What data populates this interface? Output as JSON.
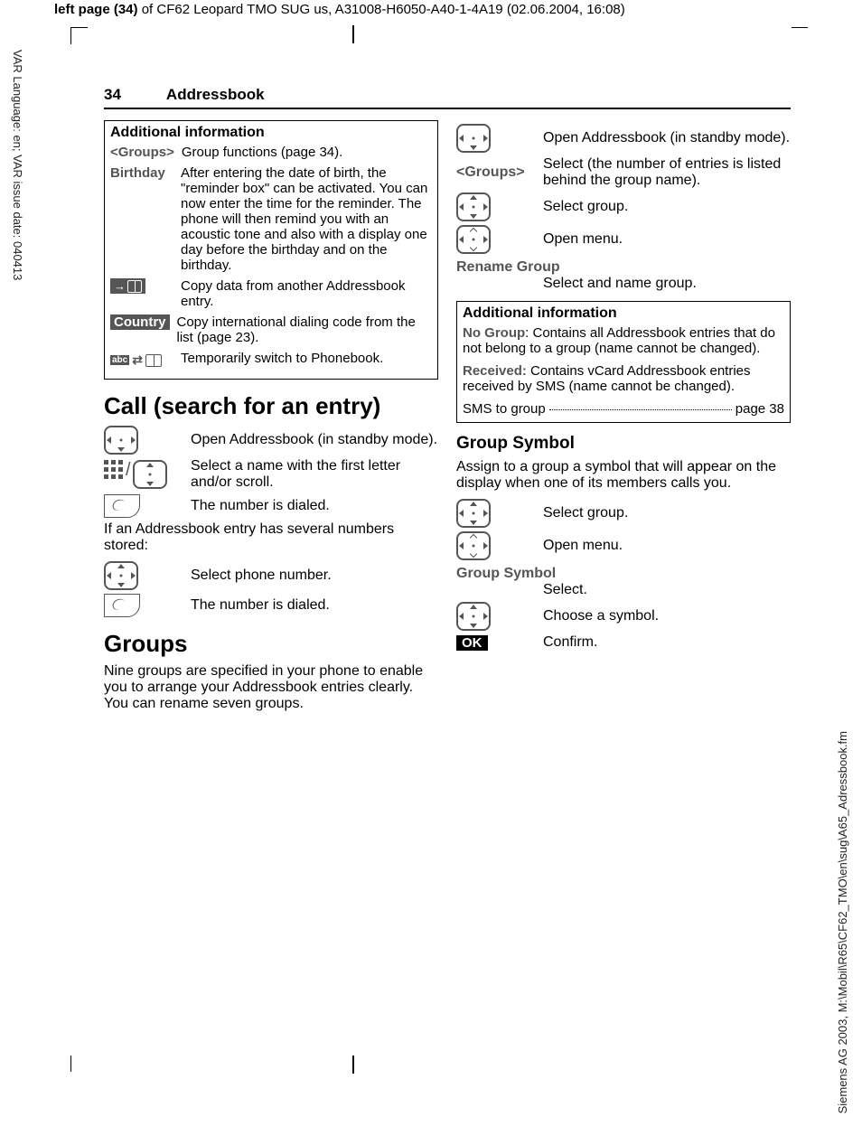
{
  "meta": {
    "header_prefix": "left page (34)",
    "header_rest": " of CF62 Leopard TMO SUG us, A31008-H6050-A40-1-4A19 (02.06.2004, 16:08)",
    "side_left": "VAR Language: en; VAR issue date: 040413",
    "side_right": "Siemens AG 2003, M:\\Mobil\\R65\\CF62_TMO\\en\\sug\\A65_Adressbook.fm"
  },
  "page": {
    "number": "34",
    "title": "Addressbook"
  },
  "left": {
    "box": {
      "title": "Additional information",
      "rows": [
        {
          "key": "<Groups>",
          "key_style": "tag",
          "val": "Group functions (page 34).",
          "icon": null
        },
        {
          "key": "Birthday",
          "key_style": "tag",
          "val": "After entering the date of birth, the \"reminder box\" can be activated. You can now enter the time for the reminder. The phone will then remind you with an acoustic tone and also with a display one day before the birthday and on the birthday.",
          "icon": null
        },
        {
          "key": "",
          "key_style": "icon-copy",
          "val": "Copy data from another Addressbook entry.",
          "icon": "copy-to-book-icon"
        },
        {
          "key": "Country",
          "key_style": "tagfill",
          "val": "Copy international dialing code from the list (page 23).",
          "icon": null
        },
        {
          "key": "",
          "key_style": "icon-swap",
          "val": "Temporarily switch to Phonebook.",
          "icon": "swap-book-icon"
        }
      ]
    },
    "h1_call": "Call (search for an entry)",
    "call_steps": [
      {
        "icon": "nav-down-icon",
        "text": "Open Addressbook (in standby mode)."
      },
      {
        "icon": "keypad-nav-icon",
        "text": "Select a name with the first letter and/or scroll."
      },
      {
        "icon": "call-key-icon",
        "text": "The number is dialed."
      }
    ],
    "call_note": "If an Addressbook entry has several numbers stored:",
    "call_steps2": [
      {
        "icon": "nav-updown-icon",
        "text": "Select phone number."
      },
      {
        "icon": "call-key-icon",
        "text": "The number is dialed."
      }
    ],
    "h1_groups": "Groups",
    "groups_para": "Nine groups are specified in your phone to enable you to arrange your Addressbook entries clearly. You can rename seven groups."
  },
  "right": {
    "open_steps": [
      {
        "icon": "nav-down-icon",
        "text": "Open Addressbook (in standby mode)."
      },
      {
        "key": "<Groups>",
        "text": "Select (the number of entries is listed behind the group name)."
      },
      {
        "icon": "nav-updown-icon",
        "text": "Select group."
      },
      {
        "icon": "nav-open-icon",
        "text": "Open menu."
      }
    ],
    "rename_label": "Rename Group",
    "rename_text": "Select and name group.",
    "box": {
      "title": "Additional information",
      "p1a": "No Group",
      "p1b": ": Contains all Addressbook entries that do not belong to a group (name cannot be changed).",
      "p2a": "Received:",
      "p2b": " Contains vCard Addressbook entries received by SMS (name cannot be changed).",
      "sms_left": "SMS to group",
      "sms_right": "page 38"
    },
    "h2_symbol": "Group Symbol",
    "symbol_para": "Assign to a group a symbol that will appear on the display when one of its members calls you.",
    "symbol_steps": [
      {
        "icon": "nav-updown-icon",
        "text": "Select group."
      },
      {
        "icon": "nav-open-icon",
        "text": "Open menu."
      }
    ],
    "symbol_label": "Group Symbol",
    "symbol_select": "Select.",
    "symbol_steps2": [
      {
        "icon": "nav-all-icon",
        "text": "Choose a symbol."
      },
      {
        "icon": "ok-badge",
        "text": "Confirm."
      }
    ]
  }
}
